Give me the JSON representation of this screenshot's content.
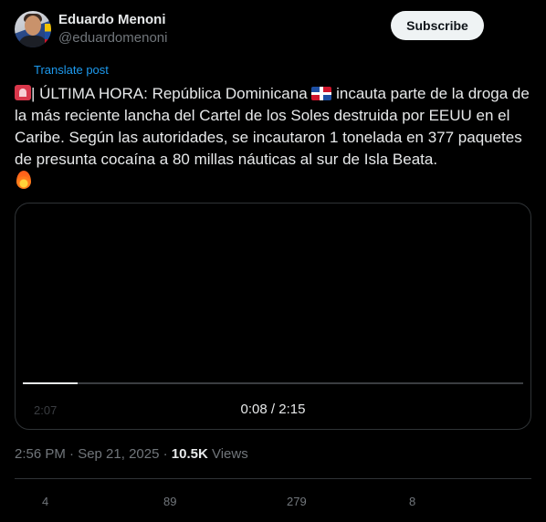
{
  "author": {
    "name": "Eduardo Menoni",
    "handle": "@eduardomenoni"
  },
  "subscribe_label": "Subscribe",
  "translate_label": "Translate post",
  "tweet": {
    "part1": "| ÚLTIMA HORA: República Dominicana ",
    "part2": " incauta parte de la droga de la más reciente lancha del Cartel de los Soles destruida por EEUU en el Caribe. Según las autoridades, se incautaron 1 tonelada en 377 paquetes de presunta cocaína a 80 millas náuticas al sur de Isla Beata. ",
    "emojis": [
      "police-light",
      "dominican-flag",
      "fire"
    ]
  },
  "video": {
    "hover_time": "2:07",
    "time_display": "0:08 / 2:15",
    "progress": 0.11
  },
  "meta": {
    "timestamp": "2:56 PM · Sep 21, 2025 · ",
    "views_count": "10.5K",
    "views_label": " Views"
  },
  "actions": {
    "replies": "4",
    "reposts": "89",
    "likes": "279",
    "bookmarks": "8"
  },
  "colors": {
    "background": "#000000",
    "text": "#e7e9ea",
    "muted": "#71767b",
    "link": "#1d9bf0",
    "border": "#2f3336"
  }
}
